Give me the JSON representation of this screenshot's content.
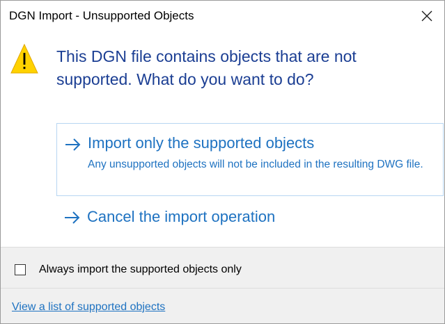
{
  "window": {
    "title": "DGN Import - Unsupported Objects"
  },
  "main": {
    "instruction": "This DGN file contains objects that are not supported. What do you want to do?",
    "icon": "warning-icon",
    "warning_color": "#ffd200",
    "accent_color": "#1e72c1",
    "instruction_color": "#1b3e93"
  },
  "commands": [
    {
      "title": "Import only the supported objects",
      "description": "Any unsupported objects will not be included in the resulting DWG file.",
      "icon": "arrow-right-icon",
      "selected": true
    },
    {
      "title": "Cancel the import operation",
      "description": "",
      "icon": "arrow-right-icon",
      "selected": false
    }
  ],
  "footer": {
    "checkbox_label": "Always import the supported objects only",
    "checkbox_checked": false,
    "link_text": "View a list of supported objects"
  }
}
